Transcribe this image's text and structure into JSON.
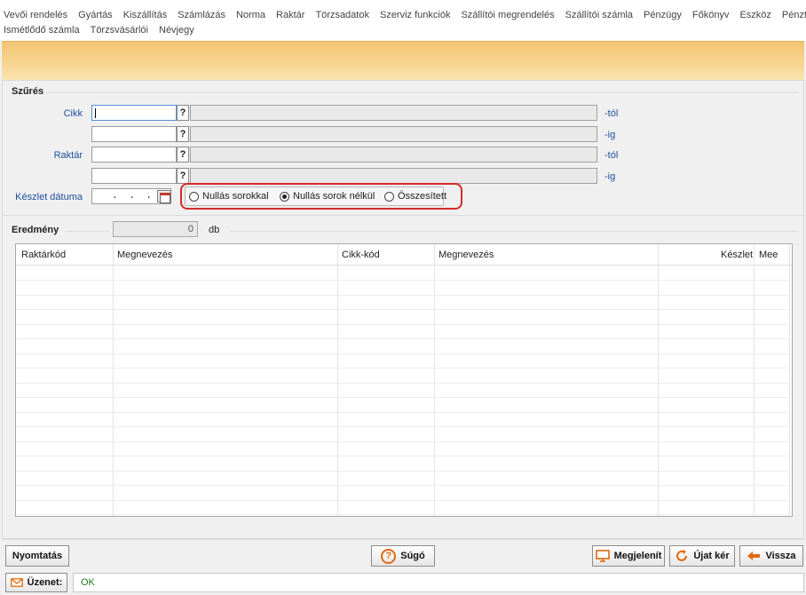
{
  "menu": {
    "row1": [
      "Vevői rendelés",
      "Gyártás",
      "Kiszállítás",
      "Számlázás",
      "Norma",
      "Raktár",
      "Törzsadatok",
      "Szerviz funkciók",
      "Szállítói megrendelés",
      "Szállítói számla",
      "Pénzügy",
      "Főkönyv",
      "Eszköz",
      "Pénztár"
    ],
    "row2": [
      "Ismétlődő számla",
      "Törzsvásárlói",
      "Névjegy"
    ]
  },
  "filter": {
    "title": "Szűrés",
    "cikk_label": "Cikk",
    "raktar_label": "Raktár",
    "from_suffix": "-tól",
    "to_suffix": "-ig",
    "lookup": "?",
    "date_label": "Készlet dátuma",
    "date_value": ". . .",
    "options": [
      "Nullás sorokkal",
      "Nullás sorok nélkül",
      "Összesített"
    ],
    "selected_option": "Nullás sorok nélkül"
  },
  "result": {
    "title": "Eredmény",
    "count": "0",
    "unit": "db",
    "columns": [
      "Raktárkód",
      "Megnevezés",
      "Cikk-kód",
      "Megnevezés",
      "Készlet",
      "Mee"
    ]
  },
  "buttons": {
    "print": "Nyomtatás",
    "help": "Súgó",
    "show": "Megjelenít",
    "new": "Újat kér",
    "back": "Vissza"
  },
  "status": {
    "label": "Üzenet:",
    "message": "OK"
  },
  "colors": {
    "accent_orange": "#e06a10",
    "highlight_red": "#d62b2b",
    "label_blue": "#1e4f9c",
    "status_green": "#1a7a1a"
  }
}
